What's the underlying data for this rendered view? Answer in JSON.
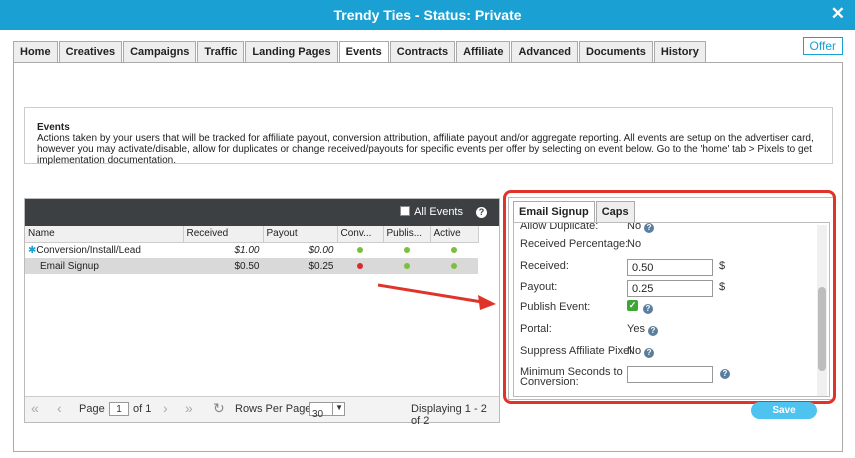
{
  "window": {
    "title": "Trendy Ties - Status: Private",
    "close": "✕"
  },
  "offer_button": "Offer",
  "tabs": [
    "Home",
    "Creatives",
    "Campaigns",
    "Traffic",
    "Landing Pages",
    "Events",
    "Contracts",
    "Affiliate",
    "Advanced",
    "Documents",
    "History"
  ],
  "events_info": {
    "heading": "Events",
    "text": "Actions taken by your users that will be tracked for affiliate payout, conversion attribution, affiliate payout and/or aggregate reporting. All events are setup on the advertiser card, however you may activate/disable, allow for duplicates or change received/payouts for specific events per offer by selecting on event below. Go to the 'home' tab > Pixels to get implementation documentation."
  },
  "grid": {
    "all_events_label": "All Events",
    "help": "?",
    "columns": [
      "Name",
      "Received",
      "Payout",
      "Conv...",
      "Publis...",
      "Active"
    ],
    "rows": [
      {
        "name": "Conversion/Install/Lead",
        "received": "$1.00",
        "payout": "$0.00",
        "conv": "green",
        "publish": "green",
        "active": "green"
      },
      {
        "name": "Email Signup",
        "received": "$0.50",
        "payout": "$0.25",
        "conv": "red",
        "publish": "green",
        "active": "green"
      }
    ],
    "pager": {
      "page_label": "Page",
      "page": "1",
      "of": "of 1",
      "rows_per_page_label": "Rows Per Page:",
      "rows_per_page": "30",
      "displaying": "Displaying 1 - 2 of 2"
    }
  },
  "detail": {
    "tabs": [
      "Email Signup",
      "Caps"
    ],
    "fields": {
      "allow_duplicate": {
        "label": "Allow Duplicate:",
        "value": "No"
      },
      "received_pct": {
        "label": "Received Percentage:",
        "value": "No"
      },
      "received": {
        "label": "Received:",
        "value": "0.50",
        "unit": "$"
      },
      "payout": {
        "label": "Payout:",
        "value": "0.25",
        "unit": "$"
      },
      "publish": {
        "label": "Publish Event:",
        "check": "✓"
      },
      "portal": {
        "label": "Portal:",
        "value": "Yes"
      },
      "suppress": {
        "label": "Suppress Affiliate Pixel:",
        "value": "No"
      },
      "min_seconds": {
        "label1": "Minimum Seconds to",
        "label2": "Conversion:",
        "value": ""
      }
    },
    "qm": "?"
  },
  "save_button": "Save",
  "colors": {
    "titlebar": "#1aa0d2",
    "highlight": "#e03329",
    "save": "#4fc3ef"
  }
}
